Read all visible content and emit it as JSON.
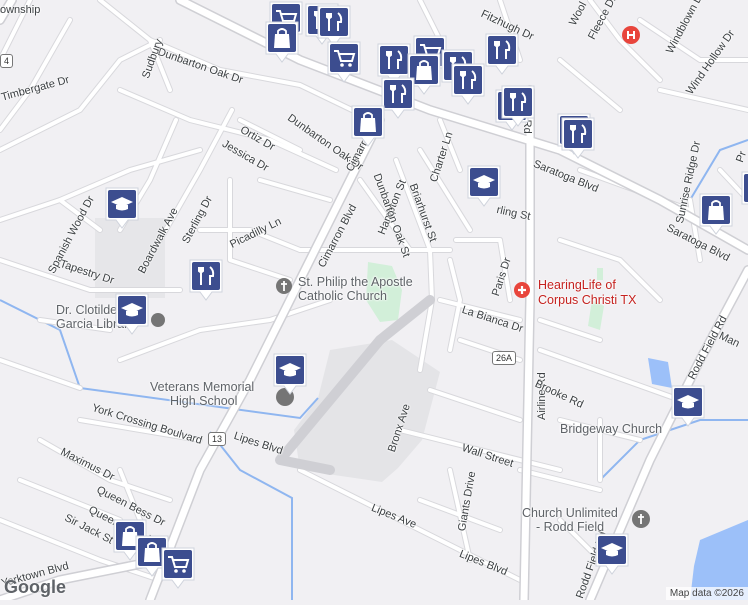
{
  "map": {
    "attribution": "Map data ©2026",
    "logo": "Google",
    "colors": {
      "background": "#f1f0f3",
      "road": "#ffffff",
      "road_outline": "#d6d6da",
      "park": "#d2efd9",
      "water": "#9cc0f9",
      "campus": "#e3e3e6",
      "marker_bg": "#3c4d8f"
    }
  },
  "street_labels": [
    {
      "id": "township",
      "text": "ownship"
    },
    {
      "id": "dunbarton-oak-dr-1",
      "text": "Dunbarton Oak Dr"
    },
    {
      "id": "sudbury",
      "text": "Sudbury"
    },
    {
      "id": "timbergate-dr",
      "text": "Timbergate Dr"
    },
    {
      "id": "ortiz-dr",
      "text": "Ortiz Dr"
    },
    {
      "id": "jessica-dr",
      "text": "Jessica Dr"
    },
    {
      "id": "dunbarton-oak-dr-2",
      "text": "Dunbarton Oak Dr"
    },
    {
      "id": "cimarron-blvd-1",
      "text": "Cimarron Blvd"
    },
    {
      "id": "cimarron-blvd-2",
      "text": "Cimarron Blvd"
    },
    {
      "id": "hampton-st",
      "text": "Hampton St"
    },
    {
      "id": "dunbarton-oak-st",
      "text": "Dunbarton Oak St"
    },
    {
      "id": "briarhurst-st",
      "text": "Briarhurst St"
    },
    {
      "id": "charter-ln",
      "text": "Charter Ln"
    },
    {
      "id": "fitzhugh-dr",
      "text": "Fitzhugh Dr"
    },
    {
      "id": "fleece-dr",
      "text": "Fleece Dr"
    },
    {
      "id": "wool",
      "text": "Wool"
    },
    {
      "id": "windblown-dr",
      "text": "Windblown Dr"
    },
    {
      "id": "wind-hollow-dr",
      "text": "Wind Hollow Dr"
    },
    {
      "id": "airline-rd-1",
      "text": "Airline Rd"
    },
    {
      "id": "airline-rd-2",
      "text": "Airline Rd"
    },
    {
      "id": "saratoga-blvd-1",
      "text": "Saratoga Blvd"
    },
    {
      "id": "saratoga-blvd-2",
      "text": "Saratoga Blvd"
    },
    {
      "id": "spanish-wood-dr",
      "text": "Spanish Wood Dr"
    },
    {
      "id": "boardwalk-ave",
      "text": "Boardwalk Ave"
    },
    {
      "id": "sterling-dr",
      "text": "Sterling Dr"
    },
    {
      "id": "picadilly-ln",
      "text": "Picadilly Ln"
    },
    {
      "id": "tapestry-dr",
      "text": "Tapestry Dr"
    },
    {
      "id": "sterling-st",
      "text": "rling St"
    },
    {
      "id": "sunrise-ridge-dr",
      "text": "Sunrise Ridge Dr"
    },
    {
      "id": "rodd-field-rd-1",
      "text": "Rodd Field Rd"
    },
    {
      "id": "rodd-field-rd-2",
      "text": "Rodd Field Rd"
    },
    {
      "id": "paris-dr",
      "text": "Paris Dr"
    },
    {
      "id": "la-bianca-dr",
      "text": "La Bianca Dr"
    },
    {
      "id": "brooke-rd",
      "text": "Brooke Rd"
    },
    {
      "id": "york-crossing-blvd",
      "text": "York Crossing Boulvard"
    },
    {
      "id": "maximus-dr",
      "text": "Maximus Dr"
    },
    {
      "id": "lipes-blvd-1",
      "text": "Lipes Blvd"
    },
    {
      "id": "lipes-blvd-2",
      "text": "Lipes Blvd"
    },
    {
      "id": "bronx-ave",
      "text": "Bronx Ave"
    },
    {
      "id": "wall-street",
      "text": "Wall Street"
    },
    {
      "id": "giants-drive",
      "text": "Giants Drive"
    },
    {
      "id": "lipes-ave",
      "text": "Lipes Ave"
    },
    {
      "id": "queen-bess-dr",
      "text": "Queen Bess Dr"
    },
    {
      "id": "queens-brook",
      "text": "Queens Brook"
    },
    {
      "id": "sir-jack-st",
      "text": "Sir Jack St"
    },
    {
      "id": "yorktown-blvd",
      "text": "Yorktown Blvd"
    },
    {
      "id": "man",
      "text": "Man"
    },
    {
      "id": "pr",
      "text": "Pr"
    }
  ],
  "places": [
    {
      "id": "st-philip",
      "line1": "St. Philip the Apostle",
      "line2": "Catholic Church",
      "icon": "church-icon"
    },
    {
      "id": "hearinglife",
      "line1": "HearingLife of",
      "line2": "Corpus Christi TX",
      "icon": "medical-icon"
    },
    {
      "id": "library",
      "line1": "Dr. Clotilde",
      "line2": "Garcia Library",
      "icon": "library-icon"
    },
    {
      "id": "veterans-memorial",
      "line1": "Veterans Memorial",
      "line2": "High School",
      "icon": "school-icon"
    },
    {
      "id": "bridgeway",
      "line1": "Bridgeway Church",
      "line2": "",
      "icon": "church-icon"
    },
    {
      "id": "church-unlimited",
      "line1": "Church Unlimited",
      "line2": "- Rodd Field",
      "icon": "church-icon"
    }
  ],
  "route_shields": [
    {
      "id": "route-13",
      "text": "13"
    },
    {
      "id": "route-26a",
      "text": "26A"
    },
    {
      "id": "route-4",
      "text": "4"
    }
  ],
  "markers": [
    {
      "type": "shopping",
      "icon": "shopping-cart-icon"
    },
    {
      "type": "restaurant",
      "icon": "restaurant-icon"
    },
    {
      "type": "restaurant",
      "icon": "restaurant-icon"
    },
    {
      "type": "shopping",
      "icon": "shopping-bag-icon"
    },
    {
      "type": "shopping",
      "icon": "shopping-cart-icon"
    },
    {
      "type": "restaurant",
      "icon": "restaurant-icon"
    },
    {
      "type": "shopping",
      "icon": "shopping-cart-icon"
    },
    {
      "type": "shopping",
      "icon": "shopping-bag-icon"
    },
    {
      "type": "restaurant",
      "icon": "restaurant-icon"
    },
    {
      "type": "restaurant",
      "icon": "restaurant-icon"
    },
    {
      "type": "restaurant",
      "icon": "restaurant-icon"
    },
    {
      "type": "restaurant",
      "icon": "restaurant-icon"
    },
    {
      "type": "restaurant",
      "icon": "restaurant-icon"
    },
    {
      "type": "restaurant",
      "icon": "restaurant-icon"
    },
    {
      "type": "shopping",
      "icon": "shopping-bag-icon"
    },
    {
      "type": "restaurant",
      "icon": "restaurant-icon"
    },
    {
      "type": "restaurant",
      "icon": "restaurant-icon"
    },
    {
      "type": "school",
      "icon": "school-icon"
    },
    {
      "type": "school",
      "icon": "school-icon"
    },
    {
      "type": "restaurant",
      "icon": "restaurant-icon"
    },
    {
      "type": "school",
      "icon": "school-icon"
    },
    {
      "type": "school",
      "icon": "school-icon"
    },
    {
      "type": "shopping",
      "icon": "shopping-bag-icon"
    },
    {
      "type": "school",
      "icon": "school-icon"
    },
    {
      "type": "school",
      "icon": "school-icon"
    },
    {
      "type": "shopping",
      "icon": "shopping-bag-icon"
    },
    {
      "type": "shopping",
      "icon": "shopping-bag-icon"
    },
    {
      "type": "shopping",
      "icon": "shopping-cart-icon"
    },
    {
      "type": "shopping",
      "icon": "shopping-bag-icon"
    }
  ]
}
